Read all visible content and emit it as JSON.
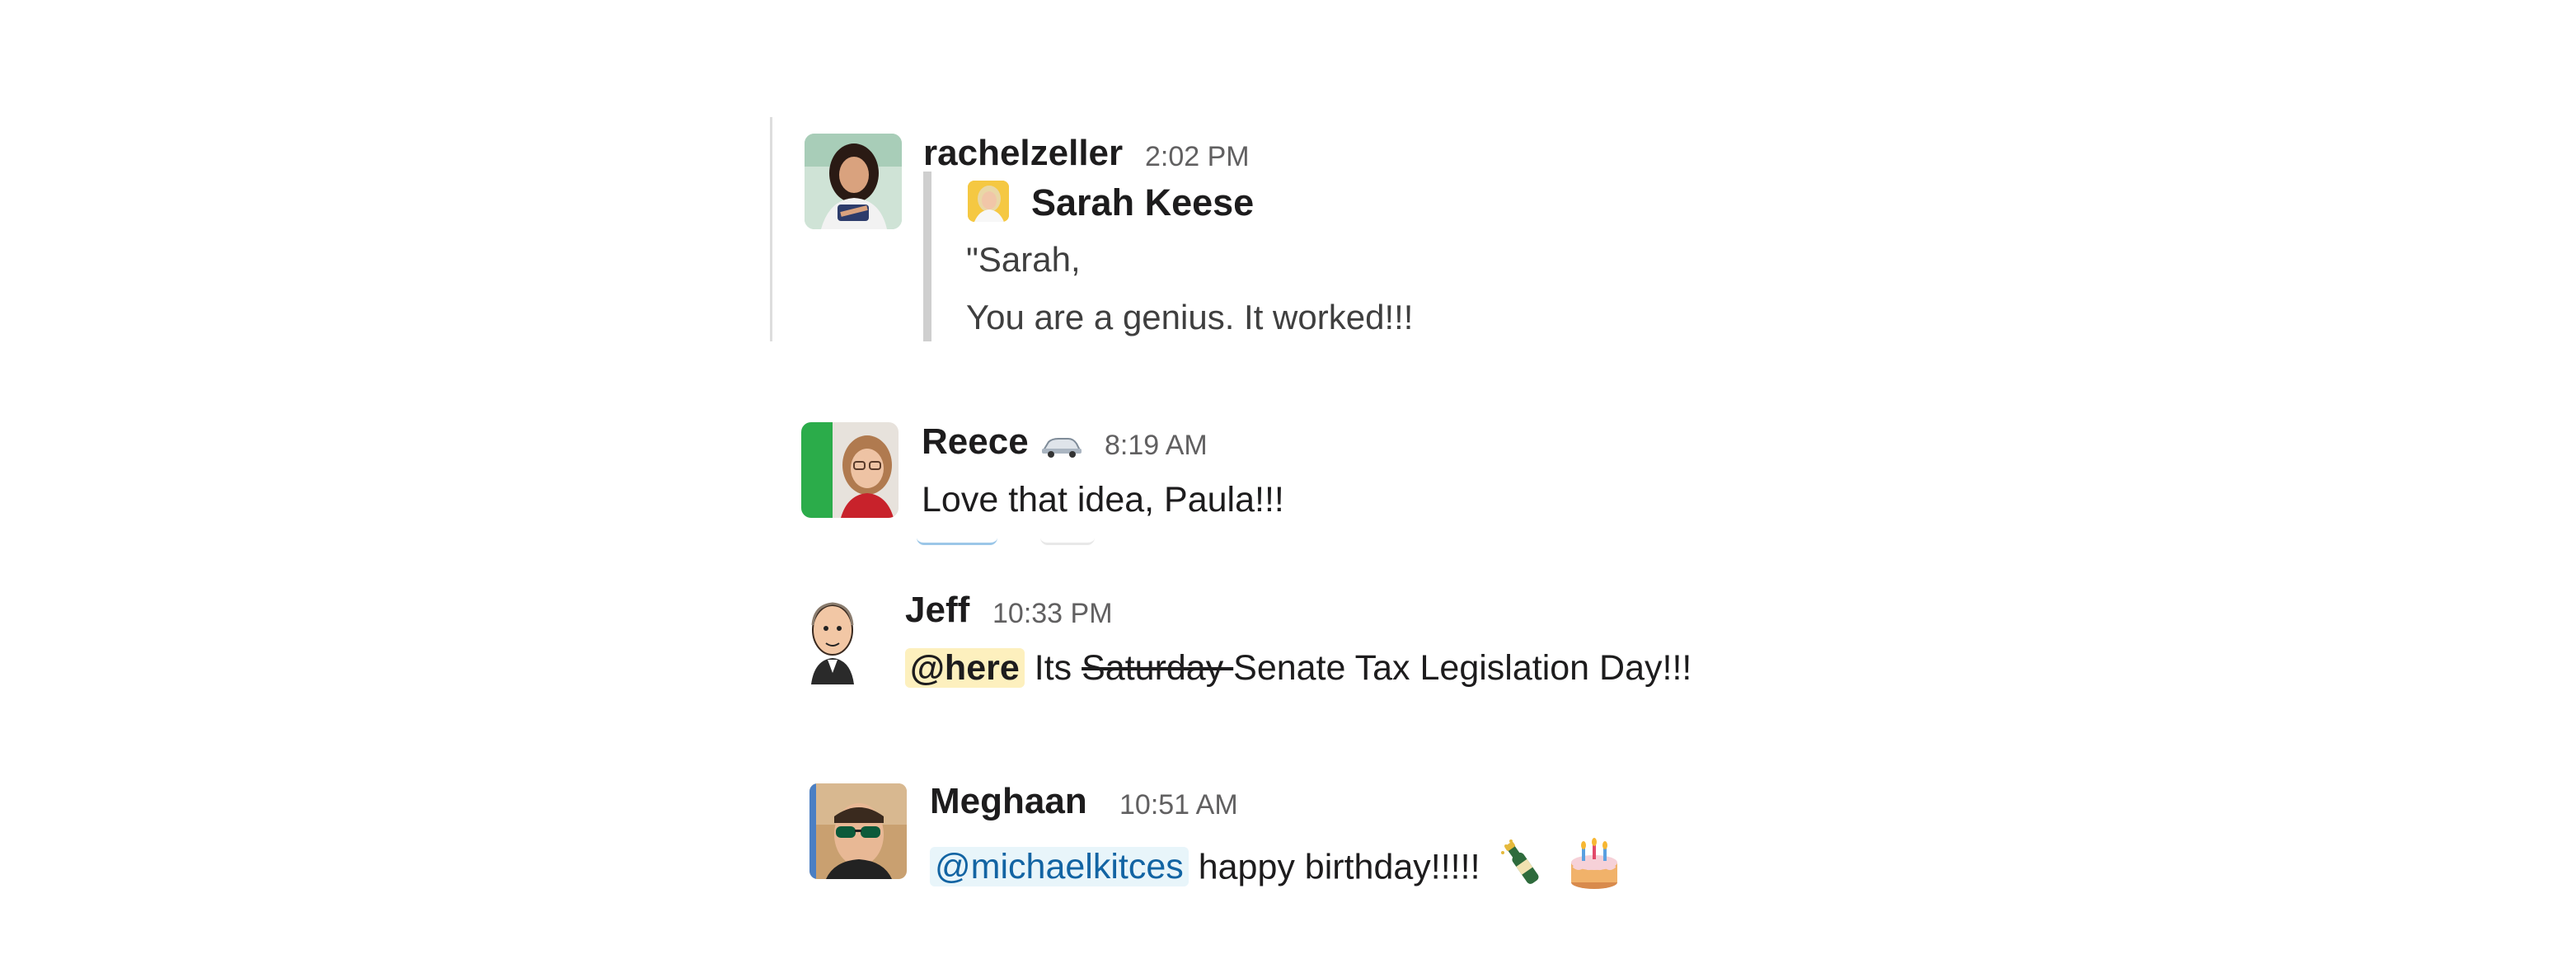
{
  "messages": [
    {
      "user": "rachelzeller",
      "time": "2:02 PM",
      "quote": {
        "author": "Sarah Keese",
        "line1": "\"Sarah,",
        "line2": "You are a genius. It worked!!!"
      }
    },
    {
      "user": "Reece",
      "status_icon": "car-emoji-icon",
      "time": "8:19 AM",
      "text": "Love that idea, Paula!!!"
    },
    {
      "user": "Jeff",
      "time": "10:33 PM",
      "mention": "@here",
      "text_before": "Its ",
      "strike": "Saturday ",
      "text_after": "Senate Tax Legislation Day!!!"
    },
    {
      "user": "Meghaan",
      "time": "10:51 AM",
      "mention": "@michaelkitces",
      "text": " happy birthday!!!!!",
      "emoji": [
        "champagne-emoji-icon",
        "birthday-cake-emoji-icon"
      ]
    }
  ],
  "colors": {
    "here_mention_bg": "#fdf0be",
    "user_mention_bg": "#e8f5fa",
    "user_mention_text": "#1264a3",
    "status_green": "#2bac4a",
    "timestamp": "#616061"
  }
}
